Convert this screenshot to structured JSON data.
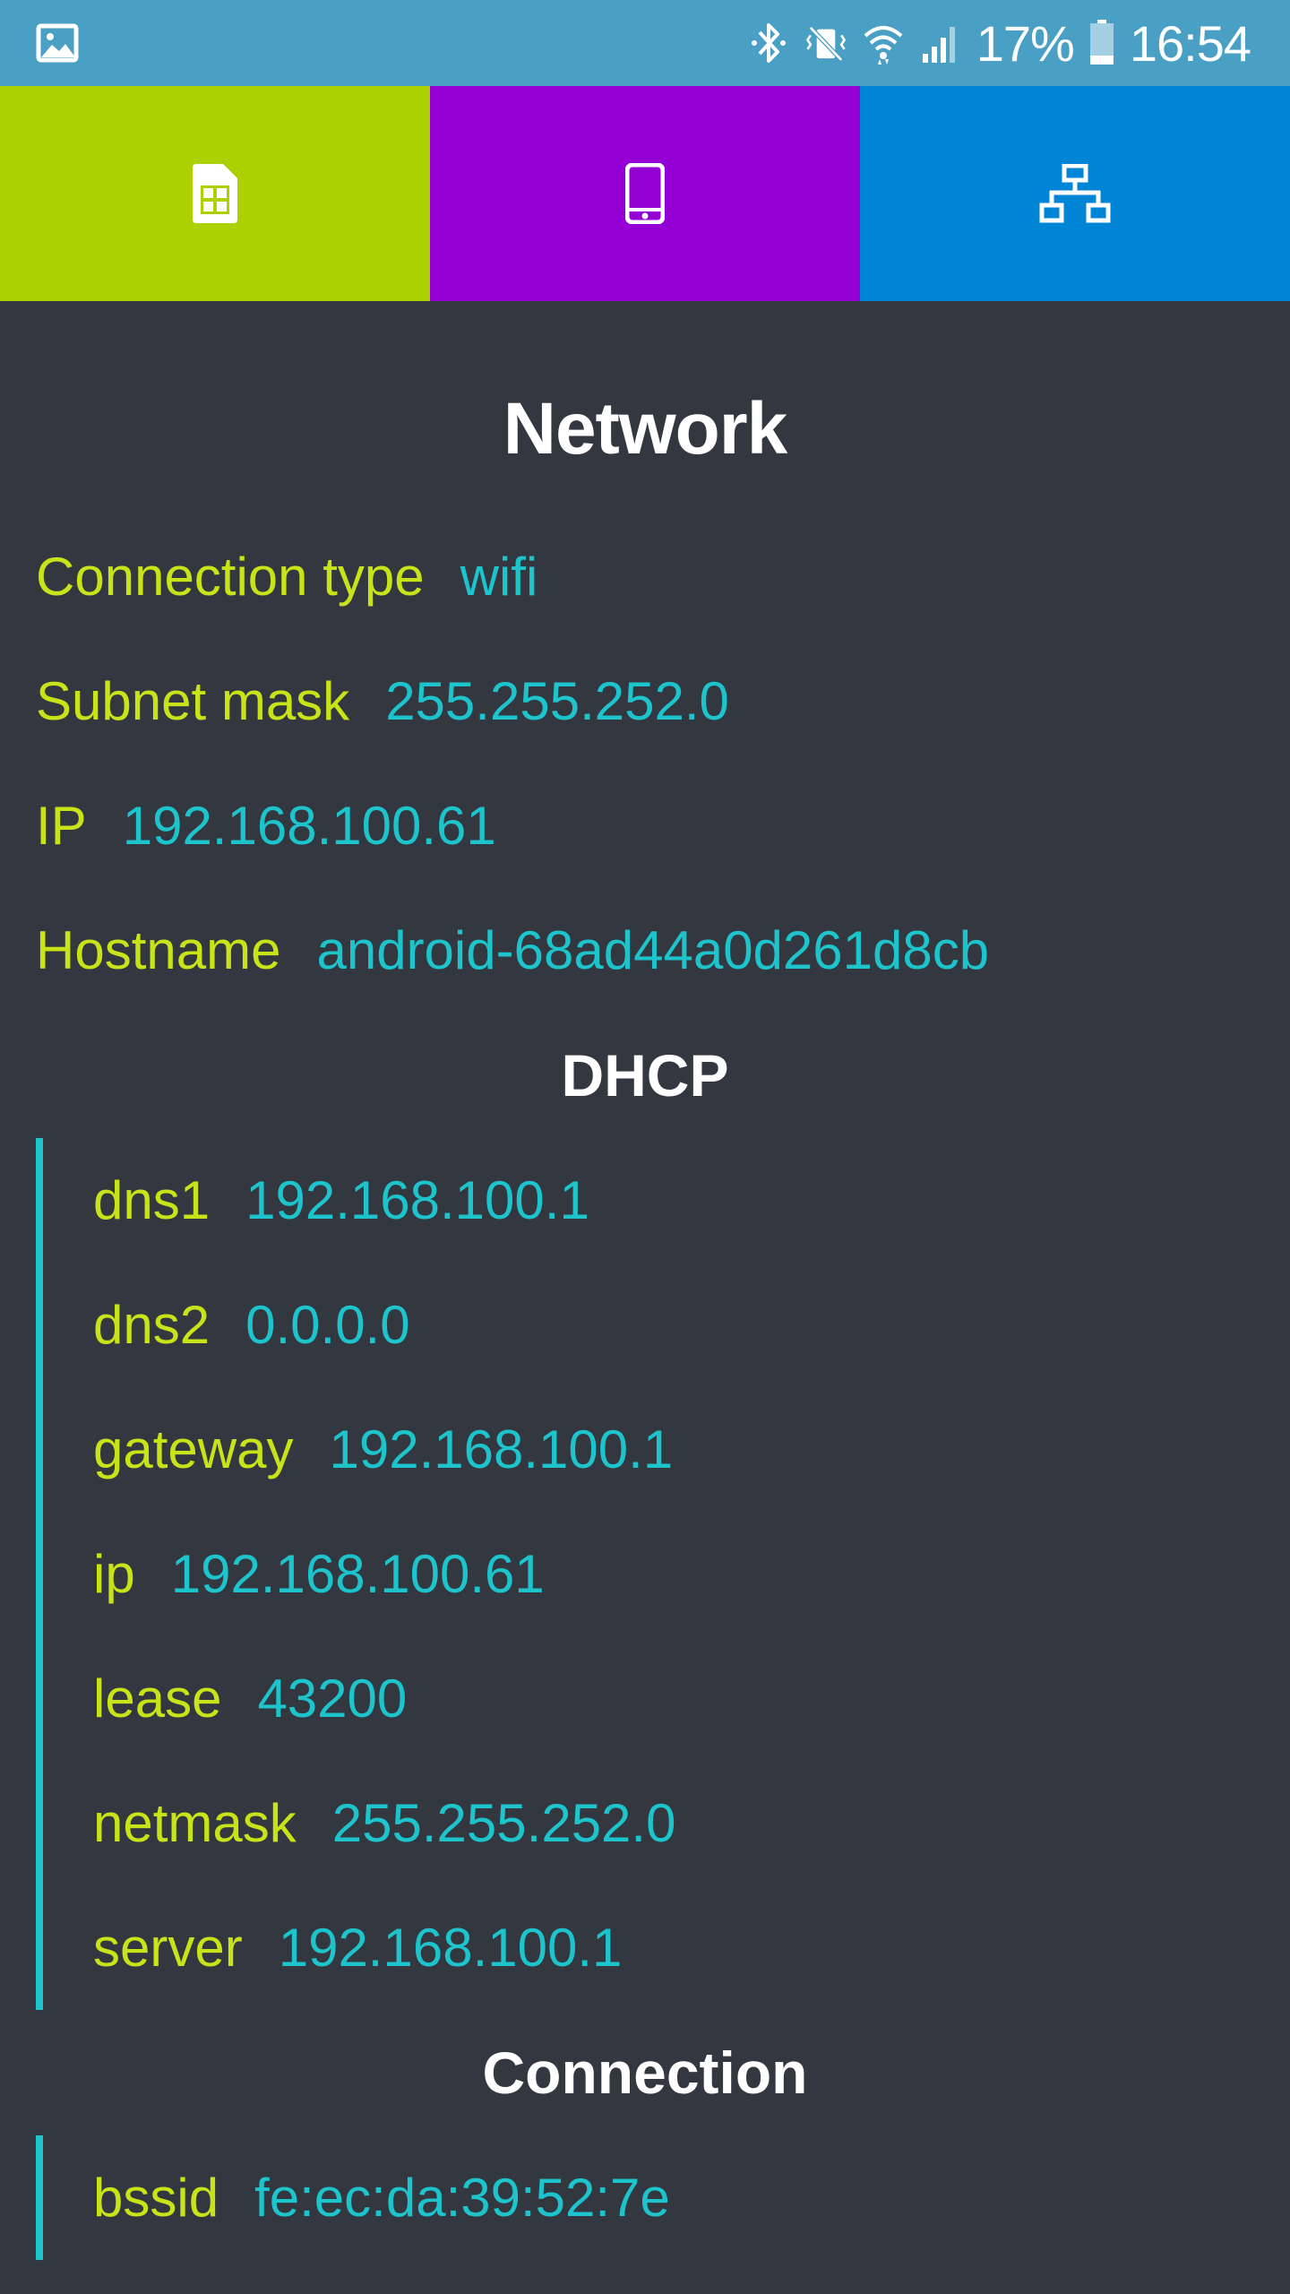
{
  "status_bar": {
    "battery": "17%",
    "time": "16:54",
    "icons": [
      "gallery-icon",
      "bluetooth-icon",
      "vibrate-icon",
      "wifi-icon",
      "cell-signal-icon",
      "battery-icon"
    ]
  },
  "tabs": [
    {
      "name": "sim",
      "icon": "sim-card-icon",
      "color": "#acd000"
    },
    {
      "name": "device",
      "icon": "smartphone-icon",
      "color": "#9400d3"
    },
    {
      "name": "network",
      "icon": "network-icon",
      "color": "#0084d6"
    }
  ],
  "colors": {
    "background": "#333740",
    "key": "#c8e418",
    "value": "#1dc4cc",
    "status_bar": "#4a9fc4"
  },
  "network": {
    "title": "Network",
    "rows": [
      {
        "key": "Connection type",
        "value": "wifi"
      },
      {
        "key": "Subnet mask",
        "value": "255.255.252.0"
      },
      {
        "key": "IP",
        "value": "192.168.100.61"
      },
      {
        "key": "Hostname",
        "value": "android-68ad44a0d261d8cb"
      }
    ]
  },
  "dhcp": {
    "title": "DHCP",
    "rows": [
      {
        "key": "dns1",
        "value": "192.168.100.1"
      },
      {
        "key": "dns2",
        "value": "0.0.0.0"
      },
      {
        "key": "gateway",
        "value": "192.168.100.1"
      },
      {
        "key": "ip",
        "value": "192.168.100.61"
      },
      {
        "key": "lease",
        "value": "43200"
      },
      {
        "key": "netmask",
        "value": "255.255.252.0"
      },
      {
        "key": "server",
        "value": "192.168.100.1"
      }
    ]
  },
  "connection": {
    "title": "Connection",
    "rows": [
      {
        "key": "bssid",
        "value": "fe:ec:da:39:52:7e"
      }
    ]
  }
}
